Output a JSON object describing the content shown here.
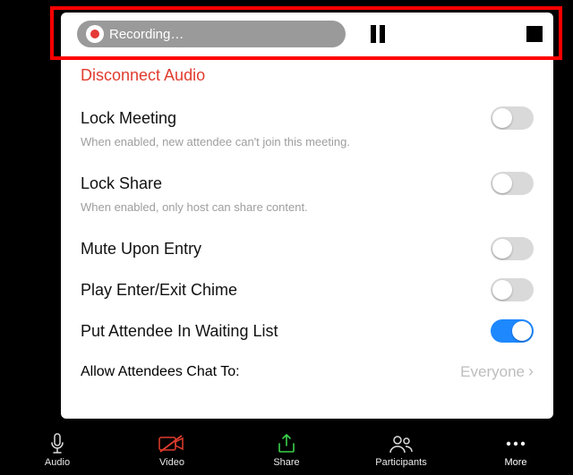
{
  "recording": {
    "status_label": "Recording…"
  },
  "menu": {
    "disconnect_audio": "Disconnect Audio",
    "lock_meeting": {
      "label": "Lock Meeting",
      "desc": "When enabled, new attendee can't join this meeting.",
      "enabled": false
    },
    "lock_share": {
      "label": "Lock Share",
      "desc": "When enabled, only host can share content.",
      "enabled": false
    },
    "mute_upon_entry": {
      "label": "Mute Upon Entry",
      "enabled": false
    },
    "enter_exit_chime": {
      "label": "Play Enter/Exit Chime",
      "enabled": false
    },
    "waiting_list": {
      "label": "Put Attendee In Waiting List",
      "enabled": true
    },
    "allow_chat": {
      "label": "Allow Attendees Chat To:",
      "value": "Everyone"
    }
  },
  "tabs": [
    {
      "label": "Audio"
    },
    {
      "label": "Video"
    },
    {
      "label": "Share"
    },
    {
      "label": "Participants"
    },
    {
      "label": "More"
    }
  ],
  "colors": {
    "danger": "#e03c2d",
    "share_accent": "#3bd14b",
    "toggle_on": "#1e88ff"
  }
}
